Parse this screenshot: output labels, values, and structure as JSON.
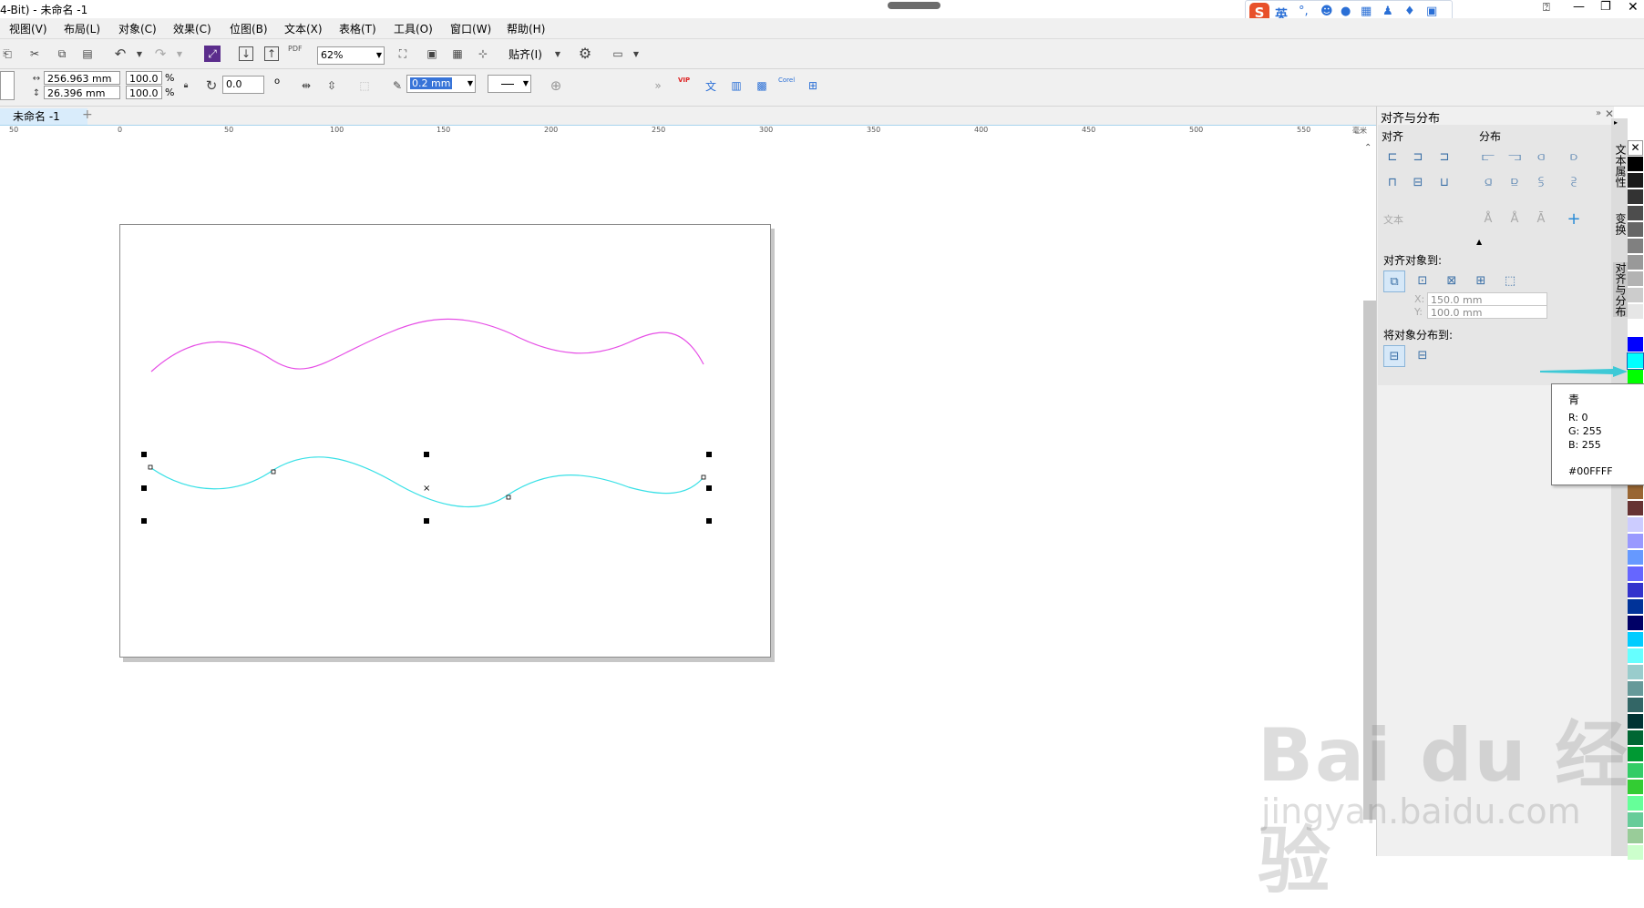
{
  "window": {
    "title": "4-Bit) - 未命名 -1"
  },
  "menu": [
    "视图(V)",
    "布局(L)",
    "对象(C)",
    "效果(C)",
    "位图(B)",
    "文本(X)",
    "表格(T)",
    "工具(O)",
    "窗口(W)",
    "帮助(H)"
  ],
  "toolbar": {
    "zoom": "62%",
    "snap_label": "贴齐(I)",
    "pdf_label": "PDF"
  },
  "property_bar": {
    "width": "256.963 mm",
    "height": "26.396 mm",
    "scale_x": "100.0",
    "scale_y": "100.0",
    "percent": "%",
    "rotation": "0.0",
    "degree": "o",
    "outline_width": "0.2 mm",
    "corel_label": "Corel",
    "vip_label": "VIP"
  },
  "document": {
    "tab": "未命名 -1",
    "add_tab": "+"
  },
  "ruler": {
    "labels": [
      "50",
      "0",
      "50",
      "100",
      "150",
      "200",
      "250",
      "300",
      "350",
      "400",
      "450",
      "500",
      "550"
    ],
    "unit": "毫米"
  },
  "panel": {
    "title": "对齐与分布",
    "align_label": "对齐",
    "distribute_label": "分布",
    "text_label": "文本",
    "align_to_label": "对齐对象到:",
    "x_label": "X:",
    "x_value": "150.0 mm",
    "y_label": "Y:",
    "y_value": "100.0 mm",
    "distribute_to_label": "将对象分布到:"
  },
  "side_tabs": {
    "text_props": "文本属性",
    "transform": "变换",
    "align": "对齐与分布"
  },
  "tooltip": {
    "name": "青",
    "r": "R: 0",
    "g": "G: 255",
    "b": "B: 255",
    "hex": "#00FFFF"
  },
  "ime": {
    "lang": "英"
  },
  "watermark": {
    "line1": "Bai du 经验",
    "line2": "jingyan.baidu.com"
  },
  "colors": {
    "magenta_curve": "#e64ee6",
    "cyan_curve": "#38e0e6",
    "accent": "#00ffff"
  },
  "palette": [
    "#000000",
    "#1a1a1a",
    "#333333",
    "#4d4d4d",
    "#666666",
    "#808080",
    "#999999",
    "#b3b3b3",
    "#cccccc",
    "#e6e6e6",
    "#ffffff",
    "#0000ff",
    "#00ffff",
    "#00ff00",
    "#ffff00",
    "#ff0000",
    "#ff00ff",
    "#993300",
    "#663300",
    "#cc9966",
    "#996633",
    "#663333",
    "#ccccff",
    "#9999ff",
    "#6699ff",
    "#6666ff",
    "#3333cc",
    "#003399",
    "#000066",
    "#00ccff",
    "#66ffff",
    "#99cccc",
    "#669999",
    "#336666",
    "#003333",
    "#006633",
    "#009933",
    "#33cc66",
    "#33cc33",
    "#66ff99",
    "#66cc99",
    "#99cc99",
    "#ccffcc"
  ]
}
